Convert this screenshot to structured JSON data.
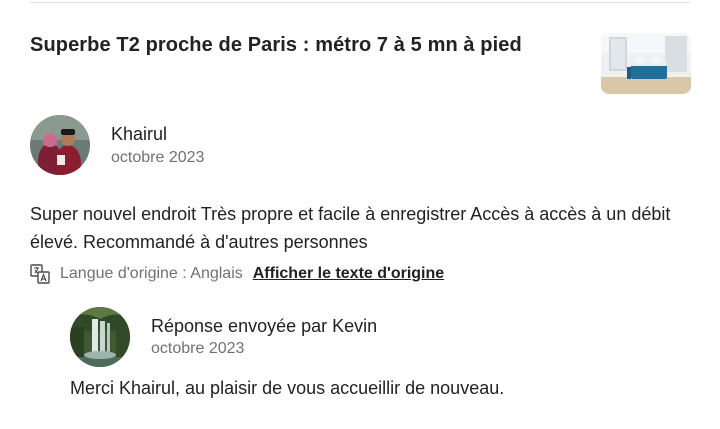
{
  "listing": {
    "title": "Superbe T2 proche de Paris : métro 7 à 5 mn à pied",
    "thumbnail_icon": "bedroom-photo"
  },
  "review": {
    "reviewer_name": "Khairul",
    "date": "octobre 2023",
    "avatar_icon": "couple-photo",
    "text": "Super nouvel endroit Très propre et facile à enregistrer Accès à accès à un débit élevé. Recommandé à d'autres personnes",
    "translation": {
      "icon": "translate-icon",
      "language_label": "Langue d'origine : Anglais",
      "show_original_link": "Afficher le texte d'origine"
    }
  },
  "response": {
    "title": "Réponse envoyée par Kevin",
    "date": "octobre 2023",
    "avatar_icon": "waterfall-photo",
    "text": "Merci Khairul, au plaisir de vous accueillir de nouveau."
  },
  "colors": {
    "text_primary": "#222222",
    "text_secondary": "#717171",
    "divider": "#dddddd"
  }
}
